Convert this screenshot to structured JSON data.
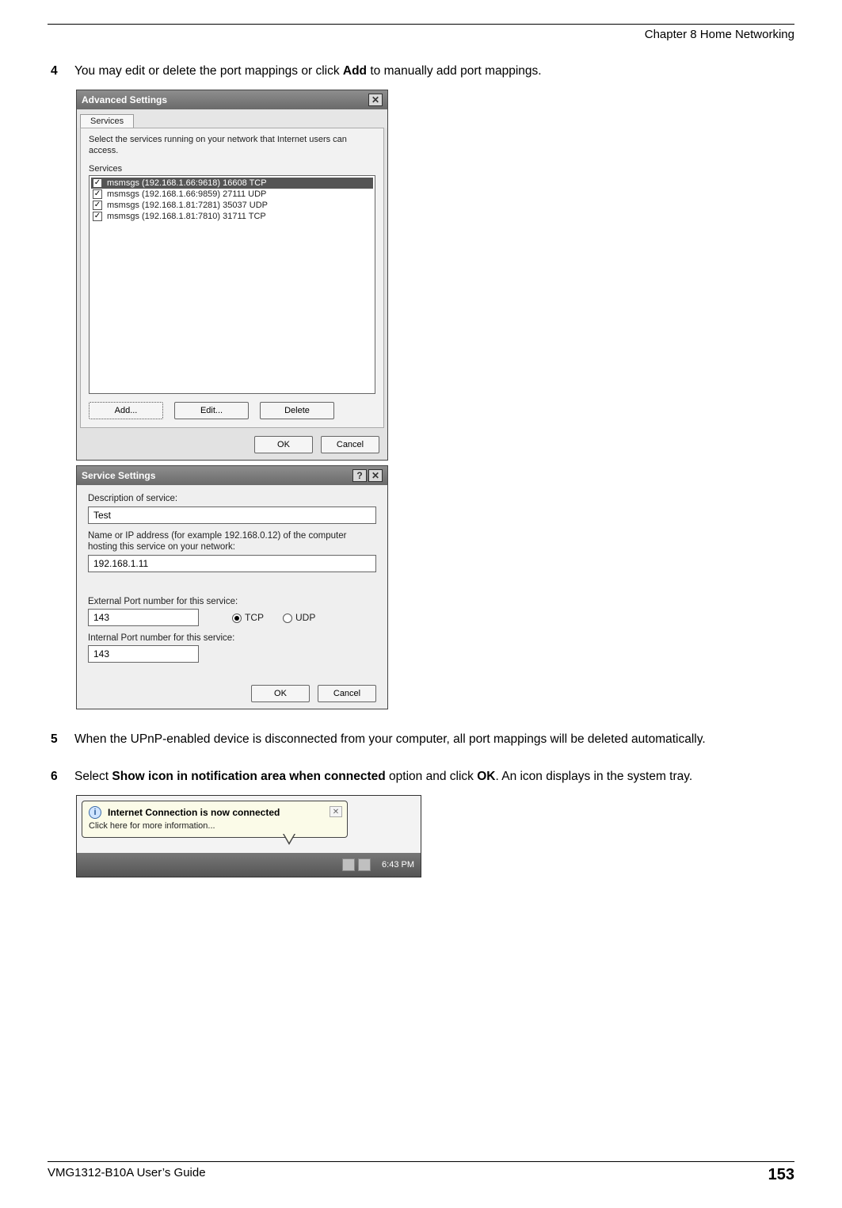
{
  "header": {
    "chapter": "Chapter 8 Home Networking"
  },
  "step4": {
    "num": "4",
    "pre": "You may edit or delete the port mappings or click ",
    "bold": "Add",
    "post": " to manually add port mappings."
  },
  "dialog1": {
    "title": "Advanced Settings",
    "tab": "Services",
    "instr_line1": "Select the services running on your network that Internet users can",
    "instr_line2": "access.",
    "svc_label": "Services",
    "rows": [
      {
        "text": "msmsgs (192.168.1.66:9618) 16608 TCP",
        "selected": true
      },
      {
        "text": "msmsgs (192.168.1.66:9859) 27111 UDP",
        "selected": false
      },
      {
        "text": "msmsgs (192.168.1.81:7281) 35037 UDP",
        "selected": false
      },
      {
        "text": "msmsgs (192.168.1.81:7810) 31711 TCP",
        "selected": false
      }
    ],
    "add_btn": "Add...",
    "edit_btn": "Edit...",
    "delete_btn": "Delete",
    "ok_btn": "OK",
    "cancel_btn": "Cancel"
  },
  "dialog2": {
    "title": "Service Settings",
    "desc_label": "Description of service:",
    "desc_value": "Test",
    "ip_label": "Name or IP address (for example 192.168.0.12) of the computer hosting this service on your network:",
    "ip_value": "192.168.1.11",
    "ext_label": "External Port number for this service:",
    "ext_value": "143",
    "tcp_label": "TCP",
    "udp_label": "UDP",
    "int_label": "Internal Port number for this service:",
    "int_value": "143",
    "ok_btn": "OK",
    "cancel_btn": "Cancel"
  },
  "step5": {
    "num": "5",
    "text": "When the UPnP-enabled device is disconnected from your computer, all port mappings will be deleted automatically."
  },
  "step6": {
    "num": "6",
    "pre": "Select ",
    "bold1": "Show icon in notification area when connected",
    "mid": " option and click ",
    "bold2": "OK",
    "post": ". An icon displays in the system tray."
  },
  "balloon": {
    "title": "Internet Connection is now connected",
    "sub": "Click here for more information...",
    "time": "6:43 PM"
  },
  "footer": {
    "guide": "VMG1312-B10A User’s Guide",
    "page": "153"
  }
}
